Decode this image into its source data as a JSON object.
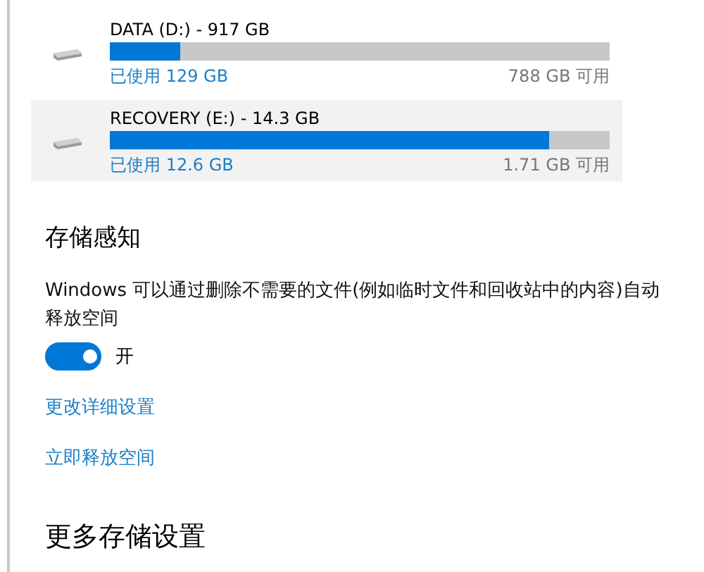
{
  "drives": [
    {
      "name": "DATA (D:) - 917 GB",
      "level": 0.14,
      "used": "已使用 129 GB",
      "free": "788 GB 可用",
      "selected": false
    },
    {
      "name": "RECOVERY (E:) - 14.3 GB",
      "level": 0.88,
      "used": "已使用 12.6 GB",
      "free": "1.71 GB 可用",
      "selected": true
    }
  ],
  "storage_sense": {
    "title": "存储感知",
    "description": "Windows 可以通过删除不需要的文件(例如临时文件和回收站中的内容)自动释放空间",
    "toggle": {
      "on": true,
      "label": "开"
    },
    "links": [
      "更改详细设置",
      "立即释放空间"
    ]
  },
  "more_settings": {
    "title": "更多存储设置"
  }
}
